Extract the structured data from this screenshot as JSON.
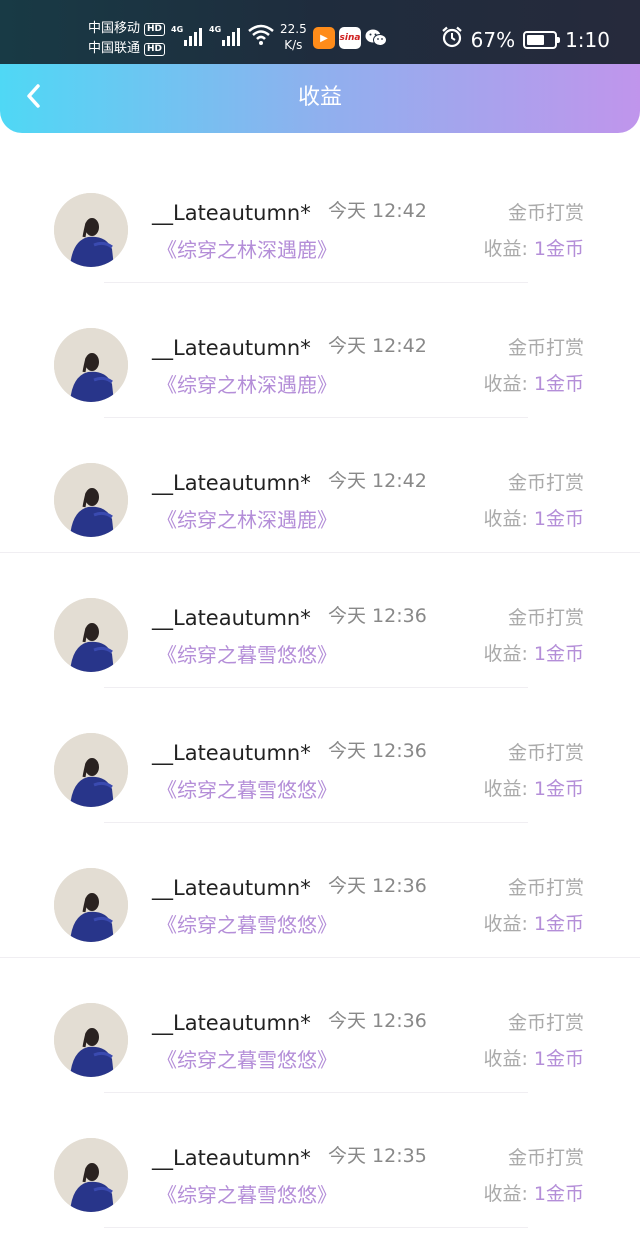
{
  "status_bar": {
    "carrier1": "中国移动",
    "carrier2": "中国联通",
    "hd": "HD",
    "network": "4G",
    "speed_value": "22.5",
    "speed_unit": "K/s",
    "sina_label": "sina",
    "battery_percent": "67%",
    "battery_level": 0.67,
    "time": "1:10"
  },
  "header": {
    "title": "收益"
  },
  "records": [
    {
      "user": "__Lateautumn*",
      "time": "今天 12:42",
      "type": "金币打赏",
      "book": "《综穿之林深遇鹿》",
      "income_label": "收益:",
      "income_amount": "1金币"
    },
    {
      "user": "__Lateautumn*",
      "time": "今天 12:42",
      "type": "金币打赏",
      "book": "《综穿之林深遇鹿》",
      "income_label": "收益:",
      "income_amount": "1金币"
    },
    {
      "user": "__Lateautumn*",
      "time": "今天 12:42",
      "type": "金币打赏",
      "book": "《综穿之林深遇鹿》",
      "income_label": "收益:",
      "income_amount": "1金币"
    },
    {
      "user": "__Lateautumn*",
      "time": "今天 12:36",
      "type": "金币打赏",
      "book": "《综穿之暮雪悠悠》",
      "income_label": "收益:",
      "income_amount": "1金币"
    },
    {
      "user": "__Lateautumn*",
      "time": "今天 12:36",
      "type": "金币打赏",
      "book": "《综穿之暮雪悠悠》",
      "income_label": "收益:",
      "income_amount": "1金币"
    },
    {
      "user": "__Lateautumn*",
      "time": "今天 12:36",
      "type": "金币打赏",
      "book": "《综穿之暮雪悠悠》",
      "income_label": "收益:",
      "income_amount": "1金币"
    },
    {
      "user": "__Lateautumn*",
      "time": "今天 12:36",
      "type": "金币打赏",
      "book": "《综穿之暮雪悠悠》",
      "income_label": "收益:",
      "income_amount": "1金币"
    },
    {
      "user": "__Lateautumn*",
      "time": "今天 12:35",
      "type": "金币打赏",
      "book": "《综穿之暮雪悠悠》",
      "income_label": "收益:",
      "income_amount": "1金币"
    }
  ],
  "colors": {
    "accent": "#b48ed8",
    "header_start": "#4fd8f5",
    "header_end": "#c095ec"
  },
  "icons": {
    "back": "chevron-left-icon",
    "alarm": "alarm-icon",
    "wifi": "wifi-icon",
    "wechat": "wechat-icon"
  }
}
